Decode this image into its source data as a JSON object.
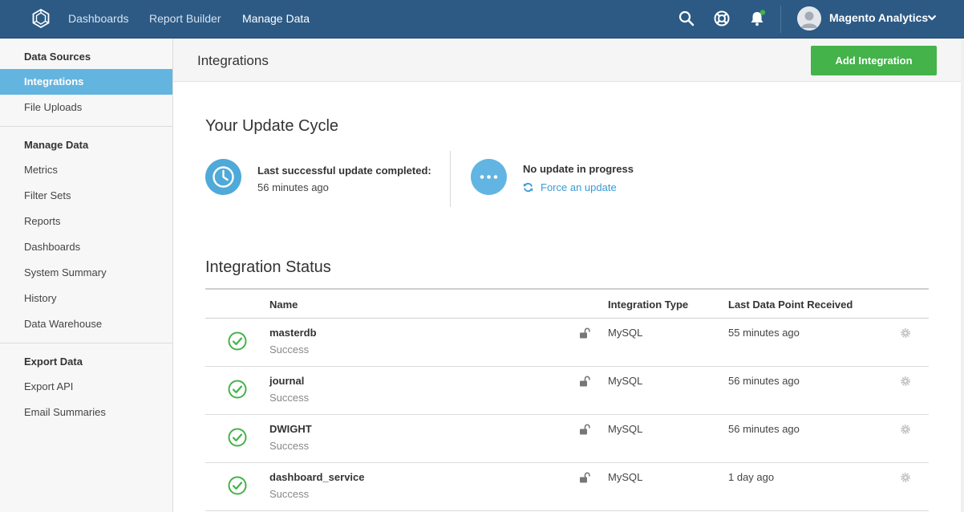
{
  "nav": {
    "links": [
      {
        "label": "Dashboards"
      },
      {
        "label": "Report Builder"
      },
      {
        "label": "Manage Data"
      }
    ],
    "icons": [
      "search-icon",
      "help-icon",
      "bell-icon"
    ],
    "user": "Magento Analytics"
  },
  "sidebar": {
    "sections": [
      {
        "heading": "Data Sources",
        "items": [
          "Integrations",
          "File Uploads"
        ]
      },
      {
        "heading": "Manage Data",
        "items": [
          "Metrics",
          "Filter Sets",
          "Reports",
          "Dashboards",
          "System Summary",
          "History",
          "Data Warehouse"
        ]
      },
      {
        "heading": "Export Data",
        "items": [
          "Export API",
          "Email Summaries"
        ]
      }
    ],
    "active_item": "Integrations"
  },
  "header": {
    "title": "Integrations",
    "add_button": "Add Integration"
  },
  "update_cycle": {
    "title": "Your Update Cycle",
    "last_label": "Last successful update completed:",
    "last_value": "56 minutes ago",
    "progress_label": "No update in progress",
    "force_link": "Force an update"
  },
  "integration_status": {
    "title": "Integration Status",
    "columns": [
      "Name",
      "Integration Type",
      "Last Data Point Received"
    ],
    "rows": [
      {
        "name": "masterdb",
        "status": "Success",
        "type": "MySQL",
        "last": "55 minutes ago"
      },
      {
        "name": "journal",
        "status": "Success",
        "type": "MySQL",
        "last": "56 minutes ago"
      },
      {
        "name": "DWIGHT",
        "status": "Success",
        "type": "MySQL",
        "last": "56 minutes ago"
      },
      {
        "name": "dashboard_service",
        "status": "Success",
        "type": "MySQL",
        "last": "1 day ago"
      }
    ]
  },
  "colors": {
    "nav_bg": "#2c5a85",
    "active_sidebar": "#64b4e0",
    "success_green": "#43b34a",
    "link_blue": "#3a9ad6"
  }
}
